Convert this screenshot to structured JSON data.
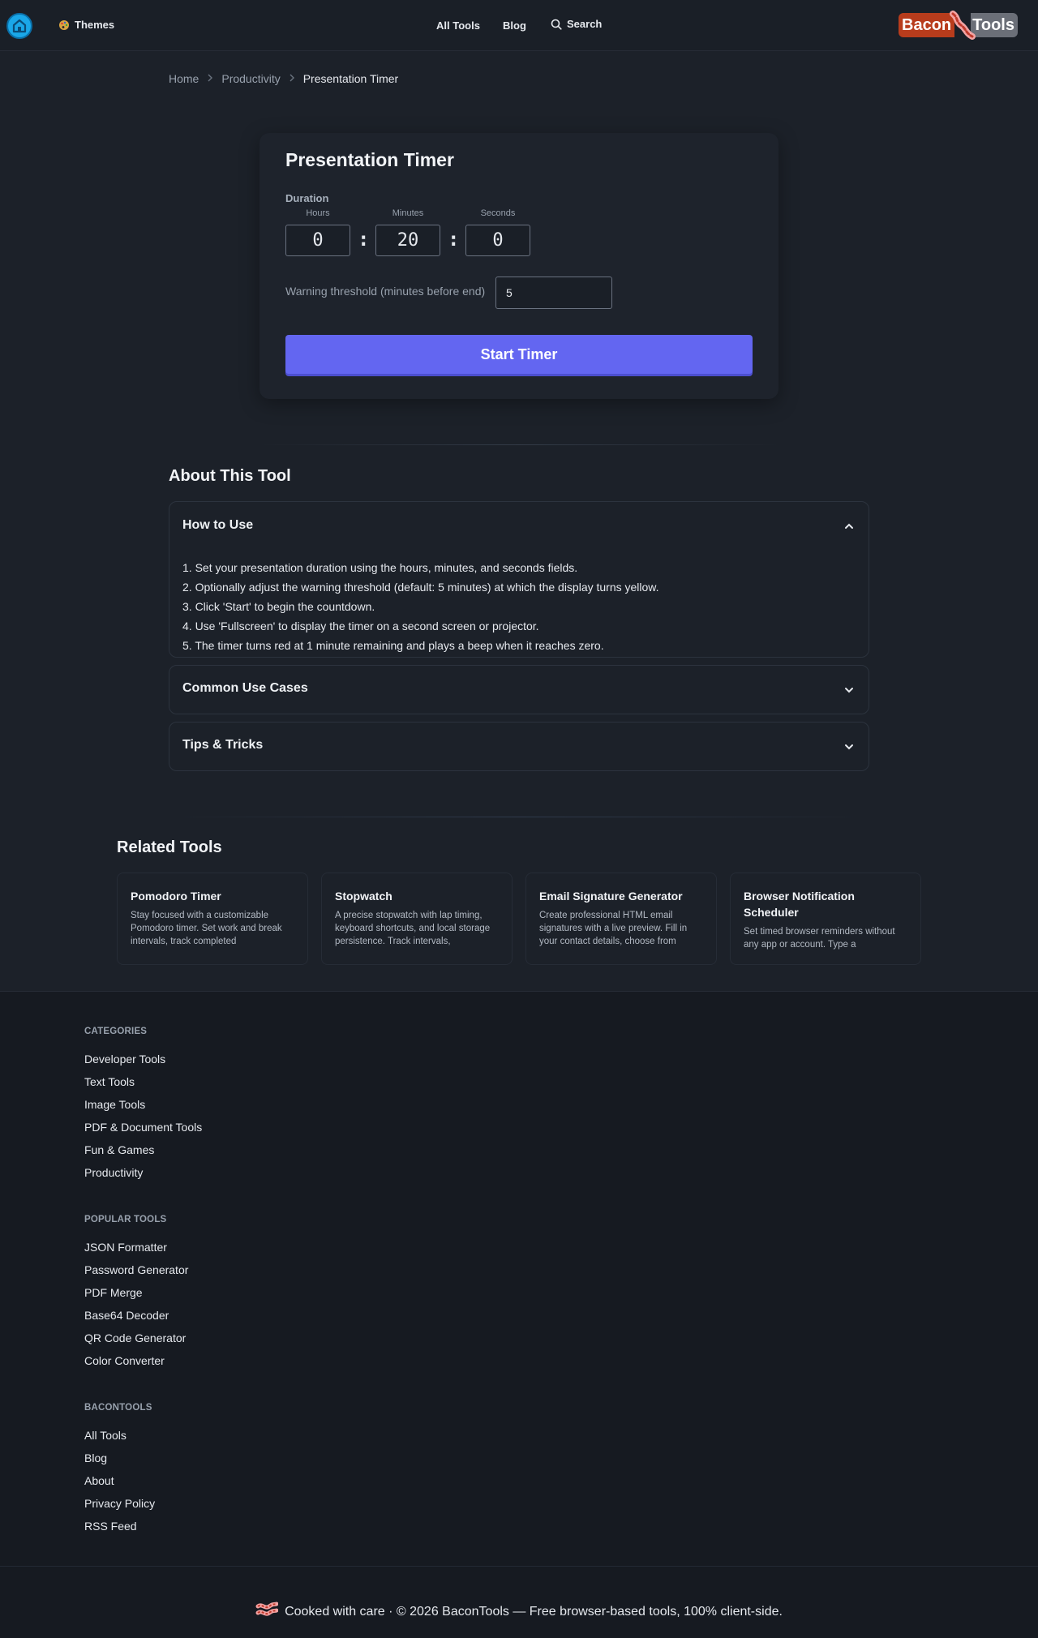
{
  "header": {
    "home_icon": "home-icon",
    "themes_label": "Themes",
    "nav": {
      "all_tools": "All Tools",
      "blog": "Blog",
      "search": "Search"
    },
    "logo": {
      "left": "Bacon",
      "right": "Tools"
    }
  },
  "breadcrumb": [
    "Home",
    "Productivity",
    "Presentation Timer"
  ],
  "timer": {
    "title": "Presentation Timer",
    "duration_label": "Duration",
    "hours_label": "Hours",
    "minutes_label": "Minutes",
    "seconds_label": "Seconds",
    "hours": "0",
    "minutes": "20",
    "seconds": "0",
    "separator": ":",
    "warning_label": "Warning threshold (minutes before end)",
    "warning_value": "5",
    "start_label": "Start Timer"
  },
  "about": {
    "title": "About This Tool",
    "sections": [
      {
        "title": "How to Use",
        "expanded": true,
        "lines": [
          "1. Set your presentation duration using the hours, minutes, and seconds fields.",
          "2. Optionally adjust the warning threshold (default: 5 minutes) at which the display turns yellow.",
          "3. Click 'Start' to begin the countdown.",
          "4. Use 'Fullscreen' to display the timer on a second screen or projector.",
          "5. The timer turns red at 1 minute remaining and plays a beep when it reaches zero."
        ]
      },
      {
        "title": "Common Use Cases",
        "expanded": false
      },
      {
        "title": "Tips & Tricks",
        "expanded": false
      }
    ]
  },
  "related": {
    "title": "Related Tools",
    "tools": [
      {
        "title": "Pomodoro Timer",
        "desc": "Stay focused with a customizable Pomodoro timer. Set work and break intervals, track completed"
      },
      {
        "title": "Stopwatch",
        "desc": "A precise stopwatch with lap timing, keyboard shortcuts, and local storage persistence. Track intervals,"
      },
      {
        "title": "Email Signature Generator",
        "desc": "Create professional HTML email signatures with a live preview. Fill in your contact details, choose from"
      },
      {
        "title": "Browser Notification Scheduler",
        "desc": "Set timed browser reminders without any app or account. Type a"
      }
    ]
  },
  "footer": {
    "categories_title": "CATEGORIES",
    "categories": [
      "Developer Tools",
      "Text Tools",
      "Image Tools",
      "PDF & Document Tools",
      "Fun & Games",
      "Productivity"
    ],
    "popular_title": "POPULAR TOOLS",
    "popular": [
      "JSON Formatter",
      "Password Generator",
      "PDF Merge",
      "Base64 Decoder",
      "QR Code Generator",
      "Color Converter"
    ],
    "bacontools_title": "BACONTOOLS",
    "bacontools": [
      "All Tools",
      "Blog",
      "About",
      "Privacy Policy",
      "RSS Feed"
    ],
    "copyright": "Cooked with care · © 2026 BaconTools — Free browser-based tools, 100% client-side."
  },
  "colors": {
    "accent": "#6366f1",
    "background": "#1c2129",
    "footer_bg": "#161a21",
    "logo_bacon": "#b83c1c",
    "logo_tools": "#6b6f78",
    "home_button": "#1aa7e8"
  }
}
